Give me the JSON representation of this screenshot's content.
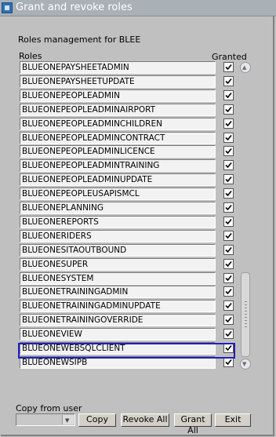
{
  "window": {
    "title": "Grant and revoke roles"
  },
  "main_label": "Roles management for BLEE",
  "headers": {
    "roles": "Roles",
    "granted": "Granted"
  },
  "roles": [
    {
      "name": "BLUEONEPAYSHEETADMIN",
      "granted": true
    },
    {
      "name": "BLUEONEPAYSHEETUPDATE",
      "granted": true
    },
    {
      "name": "BLUEONEPEOPLEADMIN",
      "granted": true
    },
    {
      "name": "BLUEONEPEOPLEADMINAIRPORT",
      "granted": true
    },
    {
      "name": "BLUEONEPEOPLEADMINCHILDREN",
      "granted": true
    },
    {
      "name": "BLUEONEPEOPLEADMINCONTRACT",
      "granted": true
    },
    {
      "name": "BLUEONEPEOPLEADMINLICENCE",
      "granted": true
    },
    {
      "name": "BLUEONEPEOPLEADMINTRAINING",
      "granted": true
    },
    {
      "name": "BLUEONEPEOPLEADMINUPDATE",
      "granted": true
    },
    {
      "name": "BLUEONEPEOPLEUSAPISMCL",
      "granted": true
    },
    {
      "name": "BLUEONEPLANNING",
      "granted": true
    },
    {
      "name": "BLUEONEREPORTS",
      "granted": true
    },
    {
      "name": "BLUEONERIDERS",
      "granted": true
    },
    {
      "name": "BLUEONESITAOUTBOUND",
      "granted": true
    },
    {
      "name": "BLUEONESUPER",
      "granted": true
    },
    {
      "name": "BLUEONESYSTEM",
      "granted": true
    },
    {
      "name": "BLUEONETRAININGADMIN",
      "granted": true
    },
    {
      "name": "BLUEONETRAININGADMINUPDATE",
      "granted": true
    },
    {
      "name": "BLUEONETRAININGOVERRIDE",
      "granted": true
    },
    {
      "name": "BLUEONEVIEW",
      "granted": true
    },
    {
      "name": "BLUEONEWEBSQLCLIENT",
      "granted": true,
      "focused": true
    },
    {
      "name": "BLUEONEWSIPB",
      "granted": true
    }
  ],
  "copy_from_user": {
    "label": "Copy from user",
    "value": ""
  },
  "buttons": {
    "copy": "Copy",
    "revoke_all": "Revoke All",
    "grant_all": "Grant All",
    "exit": "Exit"
  },
  "icons": {
    "app": "app-window-icon",
    "check": "checkmark-icon",
    "scroll_up": "scroll-up-arrow-icon",
    "scroll_down": "scroll-down-arrow-icon",
    "combo_arrow": "dropdown-arrow-icon"
  },
  "colors": {
    "focus_border": "#1f1fbf",
    "titlebar": "#a9b0b6"
  }
}
